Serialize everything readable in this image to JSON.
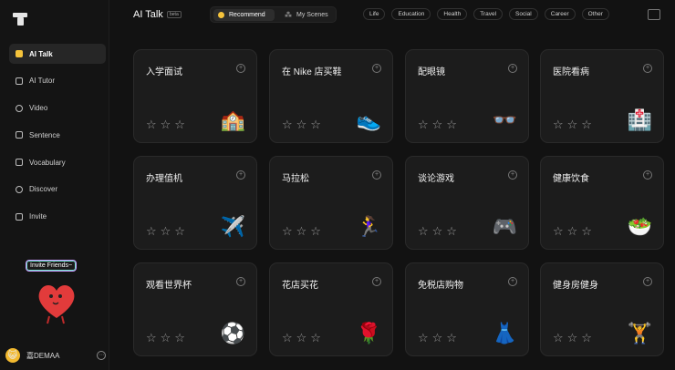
{
  "sidebar": {
    "items": [
      {
        "label": "AI Talk",
        "icon": "chat-icon",
        "active": true
      },
      {
        "label": "AI Tutor",
        "icon": "tutor-icon",
        "active": false
      },
      {
        "label": "Video",
        "icon": "play-icon",
        "active": false
      },
      {
        "label": "Sentence",
        "icon": "document-icon",
        "active": false
      },
      {
        "label": "Vocabulary",
        "icon": "book-icon",
        "active": false
      },
      {
        "label": "Discover",
        "icon": "compass-icon",
        "active": false
      },
      {
        "label": "Invite",
        "icon": "gift-icon",
        "active": false
      }
    ],
    "promo_label": "Invite Friends~",
    "user_name": "嘉DEMAA"
  },
  "header": {
    "title": "AI Talk",
    "badge": "beta",
    "tabs": [
      {
        "label": "Recommend",
        "active": true
      },
      {
        "label": "My Scenes",
        "active": false
      }
    ],
    "categories": [
      "Life",
      "Education",
      "Health",
      "Travel",
      "Social",
      "Career",
      "Other"
    ]
  },
  "cards": [
    {
      "title": "入学面试",
      "emoji": "🏫"
    },
    {
      "title": "在 Nike 店买鞋",
      "emoji": "👟"
    },
    {
      "title": "配眼镜",
      "emoji": "👓"
    },
    {
      "title": "医院看病",
      "emoji": "🏥"
    },
    {
      "title": "办理值机",
      "emoji": "✈️"
    },
    {
      "title": "马拉松",
      "emoji": "🏃‍♀️"
    },
    {
      "title": "谈论游戏",
      "emoji": "🎮"
    },
    {
      "title": "健康饮食",
      "emoji": "🥗"
    },
    {
      "title": "观看世界杯",
      "emoji": "⚽"
    },
    {
      "title": "花店买花",
      "emoji": "🌹"
    },
    {
      "title": "免税店购物",
      "emoji": "👗"
    },
    {
      "title": "健身房健身",
      "emoji": "🏋️"
    }
  ],
  "stars": "☆☆☆",
  "colors": {
    "background": "#121212",
    "card": "#1c1c1c",
    "accent": "#f5c33b"
  }
}
